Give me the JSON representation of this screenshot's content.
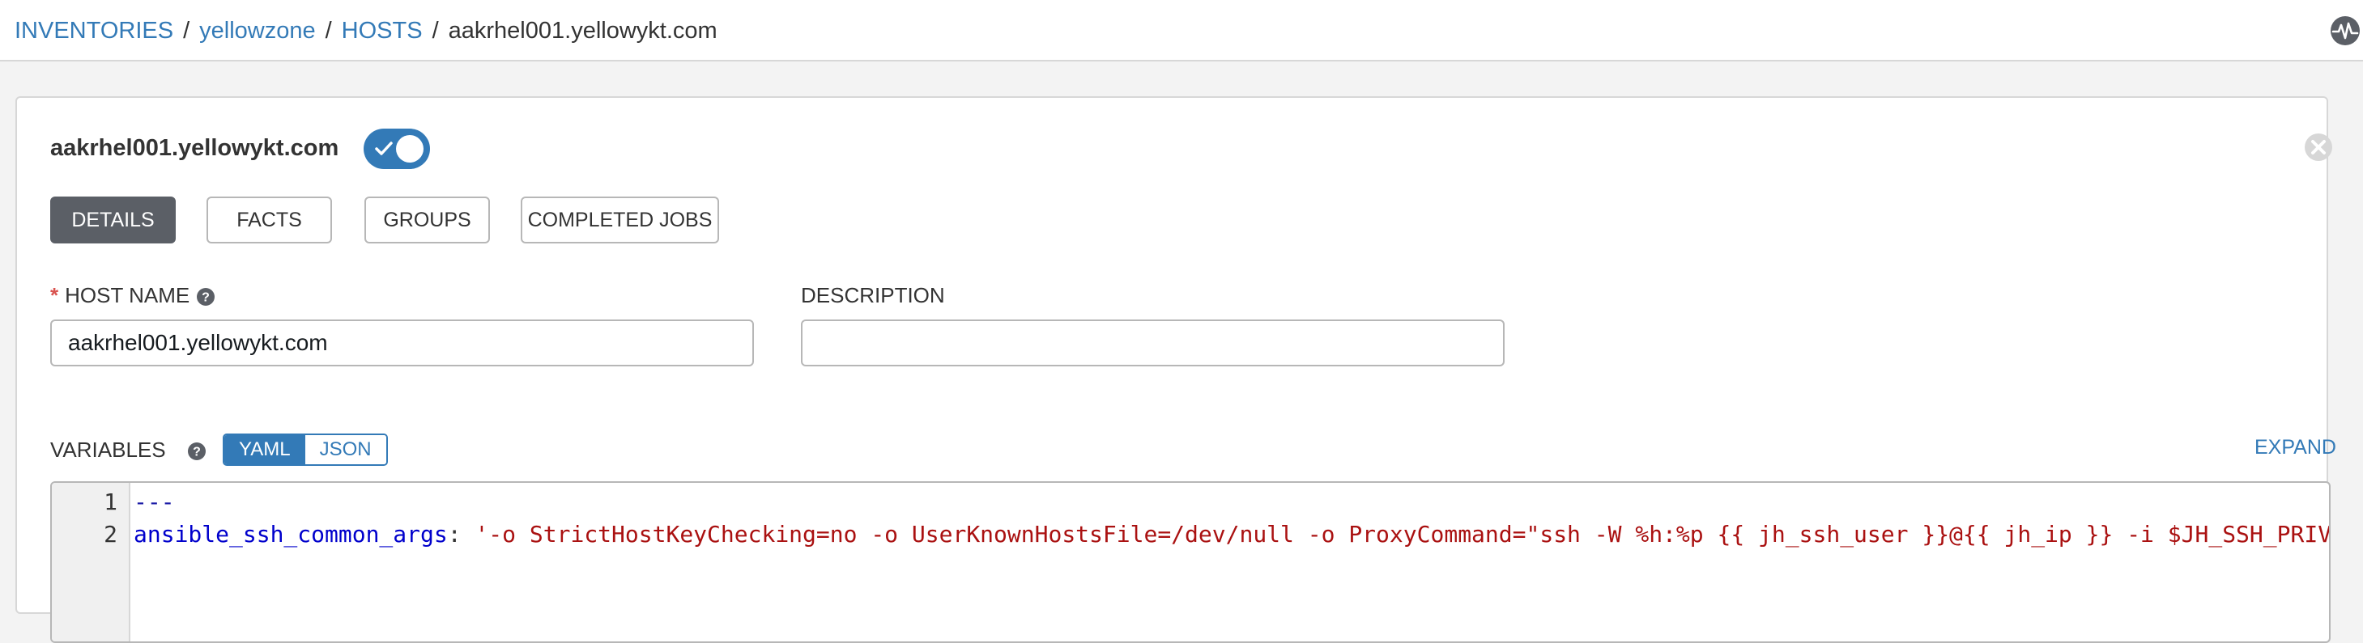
{
  "breadcrumb": {
    "items": [
      "INVENTORIES",
      "yellowzone",
      "HOSTS"
    ],
    "current": "aakrhel001.yellowykt.com",
    "separator": "/"
  },
  "header_icons": {
    "activity": "activity-stream-icon"
  },
  "host": {
    "title": "aakrhel001.yellowykt.com",
    "enabled": true
  },
  "tabs": [
    {
      "label": "DETAILS",
      "active": true
    },
    {
      "label": "FACTS",
      "active": false
    },
    {
      "label": "GROUPS",
      "active": false
    },
    {
      "label": "COMPLETED JOBS",
      "active": false
    }
  ],
  "form": {
    "host_name": {
      "required_mark": "*",
      "label": "HOST NAME",
      "value": "aakrhel001.yellowykt.com"
    },
    "description": {
      "label": "DESCRIPTION",
      "value": ""
    },
    "variables": {
      "label": "VARIABLES",
      "formats": [
        "YAML",
        "JSON"
      ],
      "active_format": "YAML",
      "expand_label": "EXPAND",
      "lines": [
        {
          "no": "1",
          "text": "---"
        },
        {
          "no": "2",
          "key": "ansible_ssh_common_args",
          "colon": ": ",
          "value": "'-o StrictHostKeyChecking=no -o UserKnownHostsFile=/dev/null -o ProxyCommand=\"ssh -W %h:%p {{ jh_ssh_user }}@{{ jh_ip }} -i $JH_SSH_PRIV"
        }
      ]
    }
  },
  "colors": {
    "primary": "#337ab7",
    "active_tab": "#5b5f66",
    "required": "#d9534f",
    "code_string": "#aa1111",
    "code_key": "#0000cc"
  }
}
